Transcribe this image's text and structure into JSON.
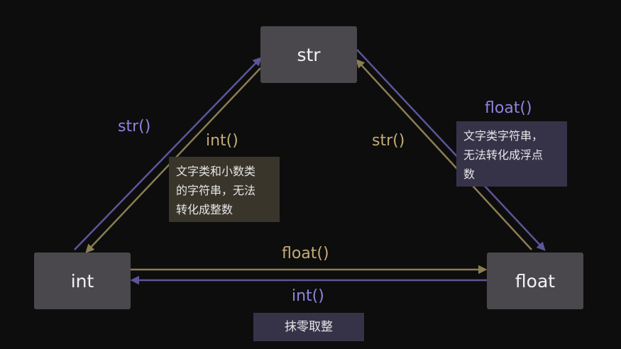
{
  "nodes": {
    "str": "str",
    "int": "int",
    "float": "float"
  },
  "labels": {
    "str_left": "str()",
    "int_left": "int()",
    "str_right": "str()",
    "float_right": "float()",
    "float_bottom": "float()",
    "int_bottom": "int()"
  },
  "notes": {
    "int_note": [
      "文字类和小数类",
      "的字符串，无法",
      "转化成整数"
    ],
    "float_note": [
      "文字类字符串，",
      "无法转化成浮点",
      "数"
    ],
    "trunc_note": "抹零取整"
  },
  "colors": {
    "background": "#0d0d0d",
    "node": "#4a484c",
    "purple": "#8f84e0",
    "gold": "#c3ac76",
    "arrow_purple": "#5d559a",
    "arrow_gold": "#8a7c54"
  }
}
